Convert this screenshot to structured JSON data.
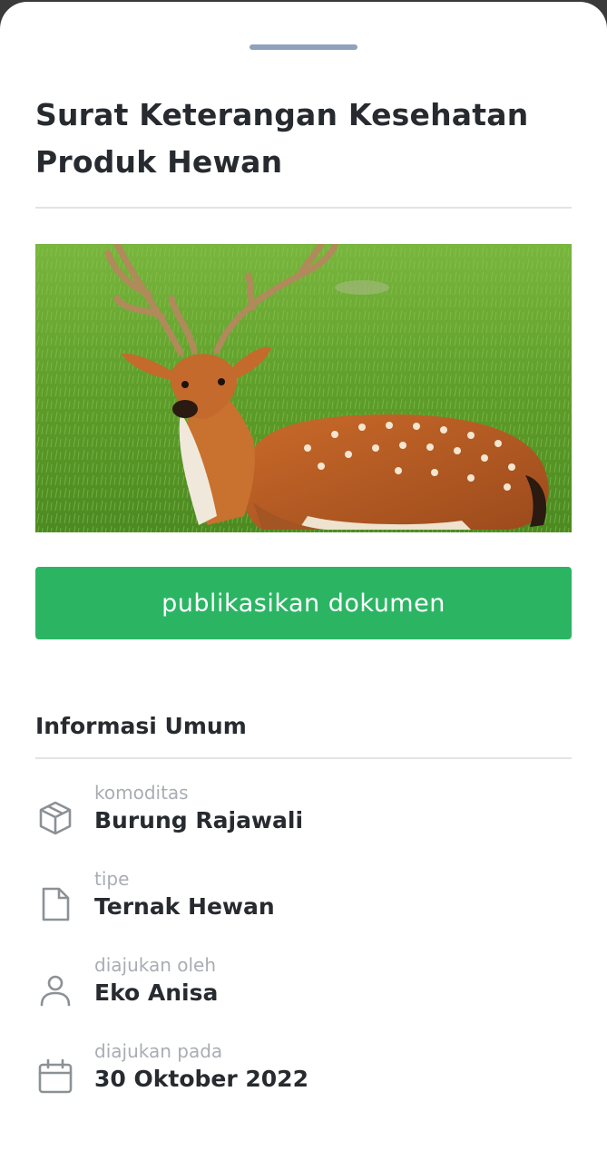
{
  "sheet": {
    "title": "Surat Keterangan Kesehatan Produk Hewan"
  },
  "photo": {
    "subject": "deer"
  },
  "actions": {
    "publish_label": "publikasikan dokumen"
  },
  "general_info": {
    "title": "Informasi Umum",
    "rows": [
      {
        "icon": "box-icon",
        "label": "komoditas",
        "value": "Burung Rajawali"
      },
      {
        "icon": "document-icon",
        "label": "tipe",
        "value": "Ternak Hewan"
      },
      {
        "icon": "user-icon",
        "label": "diajukan oleh",
        "value": "Eko Anisa"
      },
      {
        "icon": "calendar-icon",
        "label": "diajukan pada",
        "value": "30 Oktober 2022"
      }
    ]
  },
  "colors": {
    "primary_button": "#2bb563",
    "handle": "#8ea2bd",
    "text": "#272b30",
    "muted_text": "#a9adb3"
  }
}
